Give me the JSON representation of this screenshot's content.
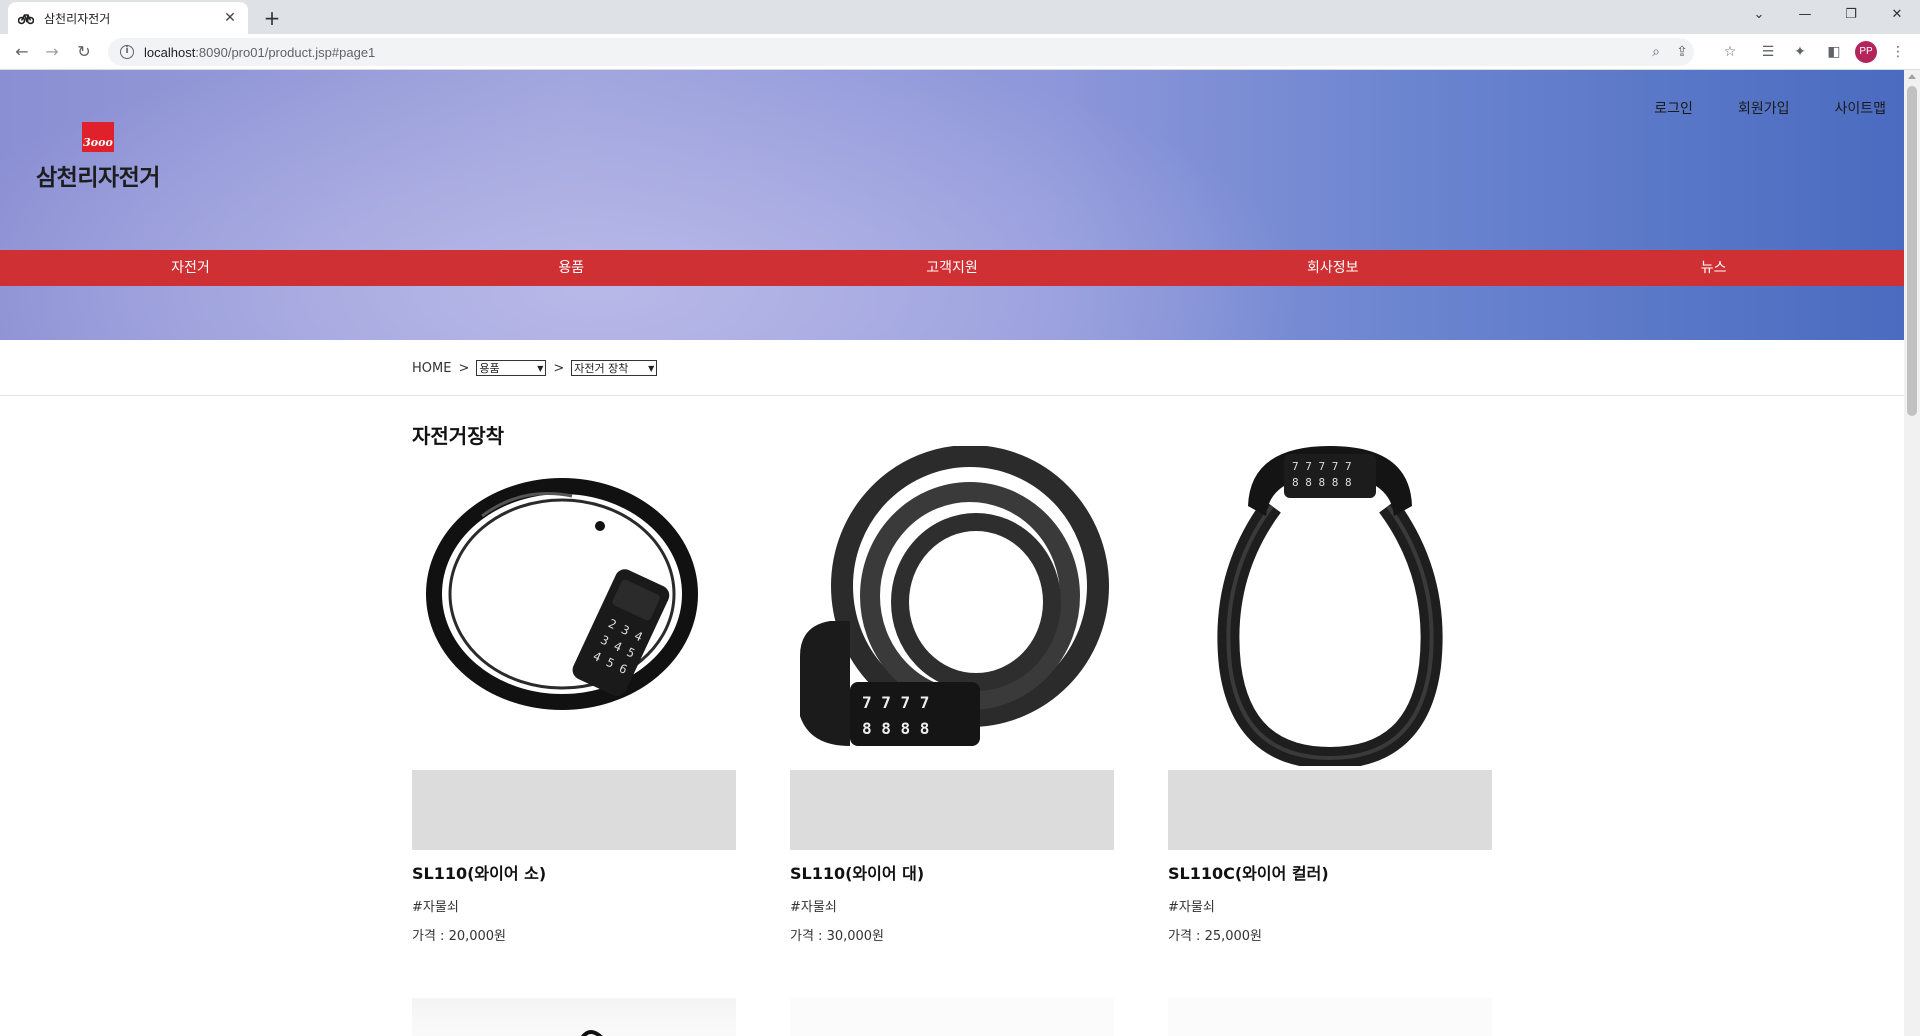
{
  "browser": {
    "tab_title": "삼천리자전거",
    "new_tab": "+",
    "url_host": "localhost",
    "url_path": ":8090/pro01/product.jsp#page1",
    "profile_initials": "PP"
  },
  "header": {
    "logo_mark": "3ooo",
    "logo_text": "삼천리자전거",
    "util_links": [
      "로그인",
      "회원가입",
      "사이트맵"
    ]
  },
  "gnb": {
    "items": [
      "자전거",
      "용품",
      "고객지원",
      "회사정보",
      "뉴스"
    ]
  },
  "breadcrumb": {
    "home": "HOME",
    "sep": ">",
    "category": "용품",
    "subcategory": "자전거 장착"
  },
  "section": {
    "title": "자전거장착"
  },
  "products": [
    {
      "name": "SL110(와이어 소)",
      "tag": "#자물쇠",
      "price": "가격 : 20,000원"
    },
    {
      "name": "SL110(와이어 대)",
      "tag": "#자물쇠",
      "price": "가격 : 30,000원"
    },
    {
      "name": "SL110C(와이어 컬러)",
      "tag": "#자물쇠",
      "price": "가격 : 25,000원"
    }
  ],
  "colors": {
    "gnb_bg": "#cf3034",
    "logo_red": "#e0202a",
    "placeholder": "#dcdcdc"
  }
}
